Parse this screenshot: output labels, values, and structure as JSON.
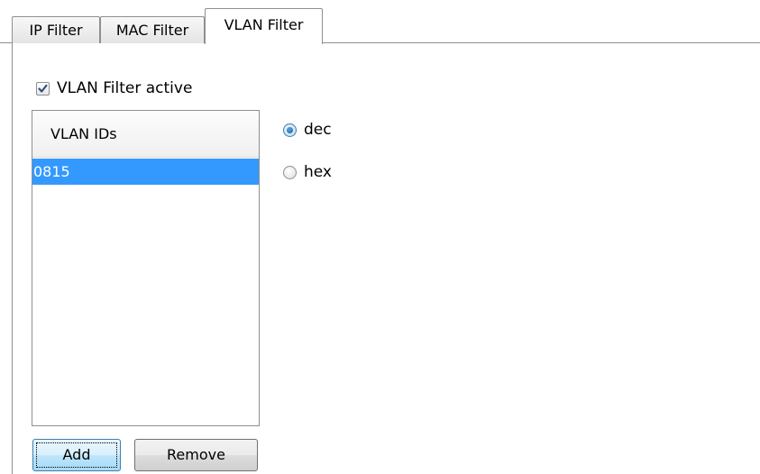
{
  "tabs": [
    {
      "label": "IP Filter",
      "active": false
    },
    {
      "label": "MAC Filter",
      "active": false
    },
    {
      "label": "VLAN Filter",
      "active": true
    }
  ],
  "vlan_filter": {
    "active_checkbox": {
      "label": "VLAN Filter active",
      "checked": true
    },
    "list": {
      "header": "VLAN IDs",
      "rows": [
        "0815"
      ],
      "selected_index": 0
    },
    "format_options": [
      {
        "label": "dec",
        "selected": true
      },
      {
        "label": "hex",
        "selected": false
      }
    ],
    "buttons": {
      "add_label": "Add",
      "remove_label": "Remove"
    }
  },
  "colors": {
    "selection": "#3399ff",
    "border": "#8e8f8f",
    "default_button_border": "#3c7fb1"
  },
  "icons": {
    "checkbox_check": "check-icon",
    "radio_selected": "radio-dot-icon"
  }
}
